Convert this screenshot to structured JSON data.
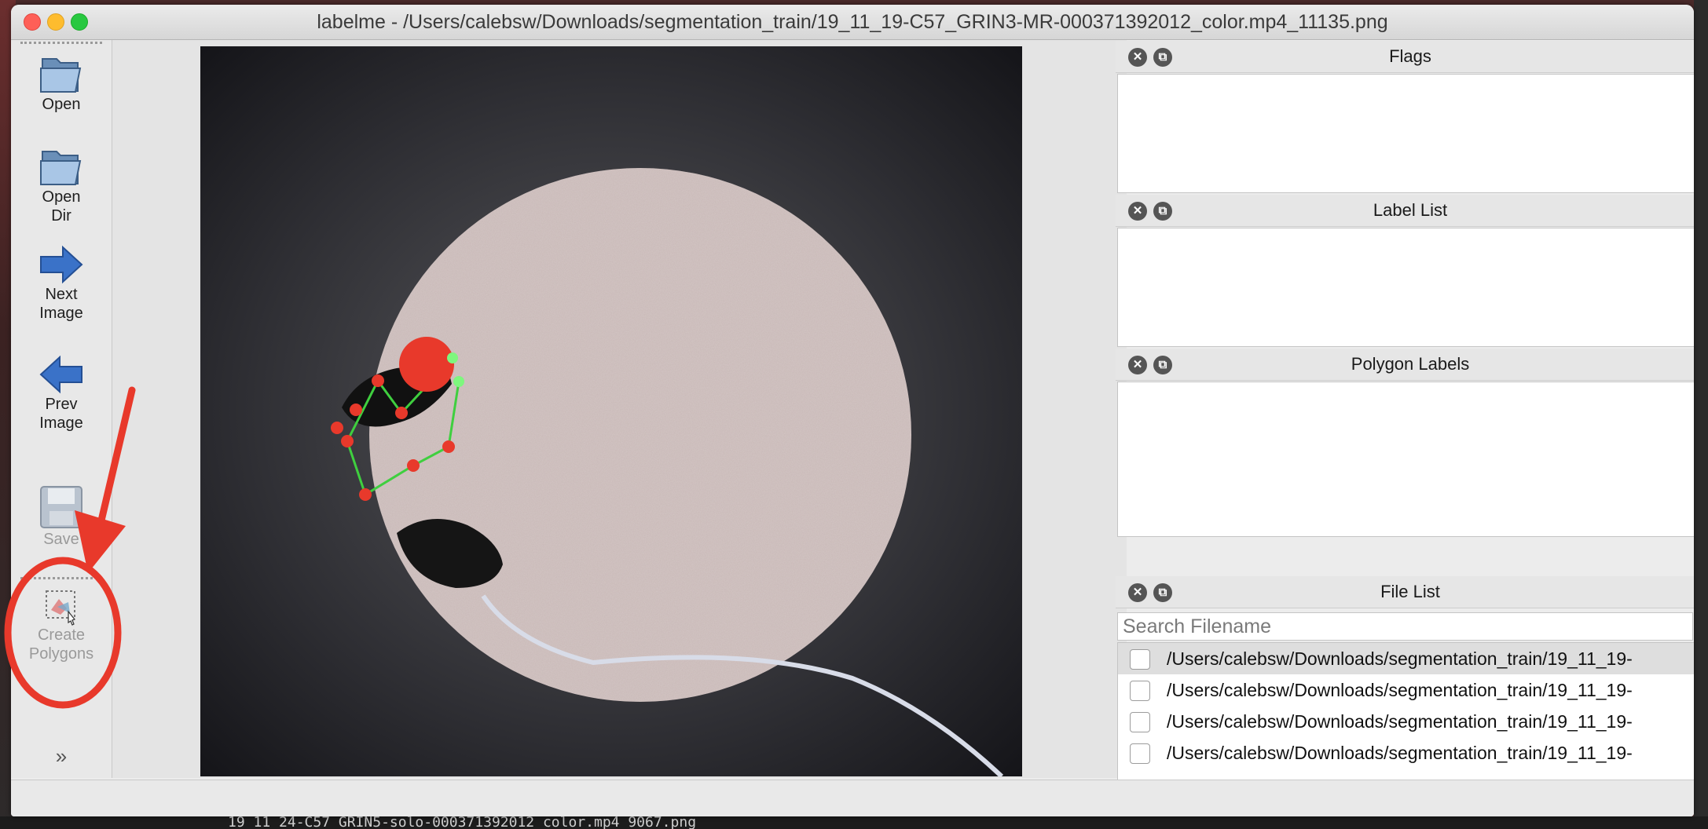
{
  "window": {
    "title": "labelme - /Users/calebsw/Downloads/segmentation_train/19_11_19-C57_GRIN3-MR-000371392012_color.mp4_11135.png"
  },
  "traffic_lights": {
    "close": "#fe5f57",
    "minimize": "#febc2e",
    "zoom": "#28c840"
  },
  "toolbar": {
    "open_label": "Open",
    "open_dir_label": "Open\nDir",
    "next_image_label": "Next\nImage",
    "prev_image_label": "Prev\nImage",
    "save_label": "Save",
    "create_polygons_label": "Create\nPolygons",
    "more_icon": "chevron-double-down-icon"
  },
  "docks": {
    "flags_title": "Flags",
    "label_list_title": "Label List",
    "polygon_labels_title": "Polygon Labels",
    "file_list_title": "File List"
  },
  "file_list": {
    "search_placeholder": "Search Filename",
    "items": [
      "/Users/calebsw/Downloads/segmentation_train/19_11_19-",
      "/Users/calebsw/Downloads/segmentation_train/19_11_19-",
      "/Users/calebsw/Downloads/segmentation_train/19_11_19-",
      "/Users/calebsw/Downloads/segmentation_train/19_11_19-"
    ]
  },
  "background_terminal_text": "19_11_24-C57_GRIN5-solo-000371392012_color.mp4_9067.png",
  "annotation_colors": {
    "highlight": "#e8392b",
    "polygon_edge": "#3fcf3f"
  }
}
